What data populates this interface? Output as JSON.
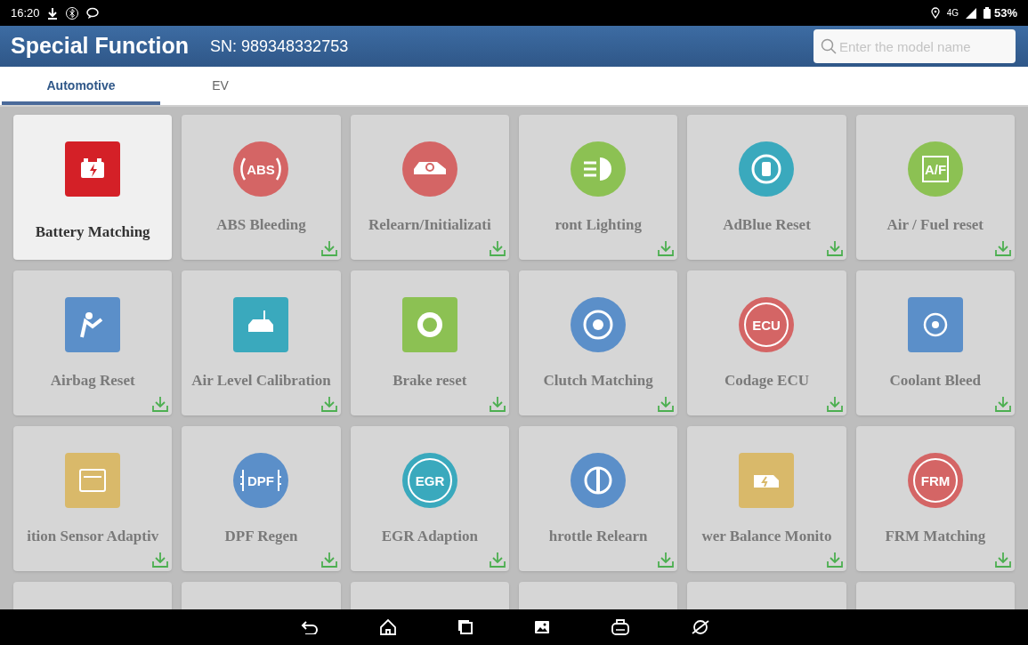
{
  "status_bar": {
    "time": "16:20",
    "network": "4G",
    "battery": "53%"
  },
  "header": {
    "title": "Special Function",
    "serial_label": "SN:",
    "serial": "989348332753",
    "search": {
      "placeholder": "Enter the model name"
    }
  },
  "tabs": [
    {
      "label": "Automotive",
      "selected": true
    },
    {
      "label": "EV",
      "selected": false
    }
  ],
  "functions": [
    {
      "label": "Battery Matching",
      "kind": "square",
      "color": "#d42027",
      "downloadable": false
    },
    {
      "label": "ABS Bleeding",
      "kind": "circle",
      "color": "#d46565",
      "badge": "ABS",
      "downloadable": true
    },
    {
      "label": "Relearn/Initializati",
      "kind": "circle",
      "color": "#d46565",
      "downloadable": true
    },
    {
      "label": "ront Lighting",
      "kind": "circle",
      "color": "#8cc153",
      "downloadable": true
    },
    {
      "label": "AdBlue Reset",
      "kind": "circle",
      "color": "#3aa9bd",
      "downloadable": true
    },
    {
      "label": "Air / Fuel reset",
      "kind": "circle",
      "color": "#8cc153",
      "badge": "A/F",
      "downloadable": true
    },
    {
      "label": "Airbag Reset",
      "kind": "square",
      "color": "#5b8fc9",
      "downloadable": true
    },
    {
      "label": "Air Level Calibration",
      "kind": "square",
      "color": "#3aa9bd",
      "downloadable": true
    },
    {
      "label": "Brake reset",
      "kind": "square",
      "color": "#8cc153",
      "downloadable": true
    },
    {
      "label": "Clutch Matching",
      "kind": "circle",
      "color": "#5b8fc9",
      "downloadable": true
    },
    {
      "label": "Codage ECU",
      "kind": "circle",
      "color": "#d46565",
      "badge": "ECU",
      "downloadable": true
    },
    {
      "label": "Coolant Bleed",
      "kind": "square",
      "color": "#5b8fc9",
      "downloadable": true
    },
    {
      "label": "ition Sensor Adaptiv",
      "kind": "square",
      "color": "#d9b96a",
      "downloadable": true
    },
    {
      "label": "DPF Regen",
      "kind": "circle",
      "color": "#5b8fc9",
      "badge": "DPF",
      "downloadable": true
    },
    {
      "label": "EGR Adaption",
      "kind": "circle",
      "color": "#3aa9bd",
      "badge": "EGR",
      "downloadable": true
    },
    {
      "label": "hrottle Relearn",
      "kind": "circle",
      "color": "#5b8fc9",
      "downloadable": true
    },
    {
      "label": "wer Balance Monito",
      "kind": "square",
      "color": "#d9b96a",
      "downloadable": true
    },
    {
      "label": "FRM Matching",
      "kind": "circle",
      "color": "#d46565",
      "badge": "FRM",
      "downloadable": true
    }
  ]
}
